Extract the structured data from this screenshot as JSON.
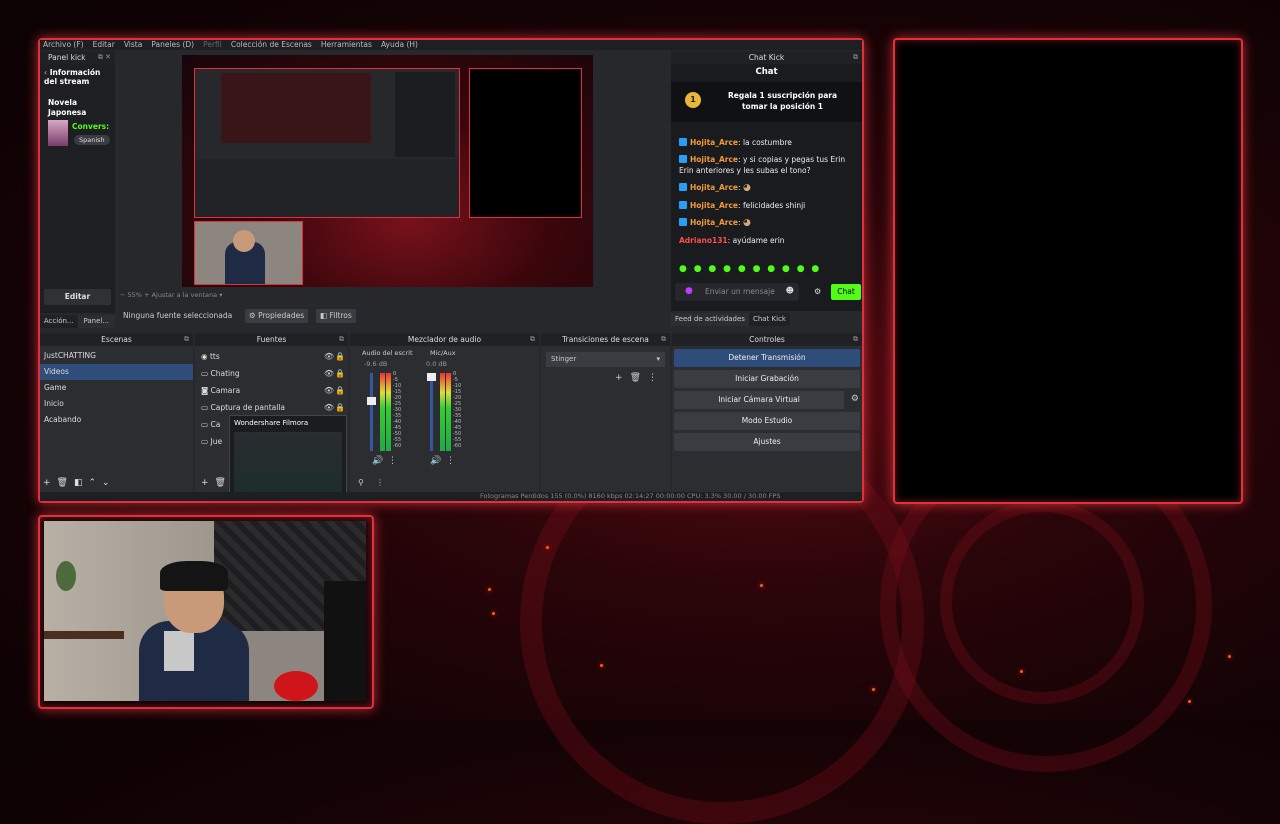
{
  "menu": {
    "items": [
      "Archivo (F)",
      "Editar",
      "Vista",
      "Paneles (D)",
      "Perfil",
      "Colección de Escenas",
      "Herramientas",
      "Ayuda (H)"
    ]
  },
  "panel_kick": {
    "title": "Panel kick",
    "stream_info_title": "Información del stream",
    "category": "Novela Japonesa",
    "conv": "Convers:",
    "language": "Spanish",
    "edit_button": "Editar"
  },
  "bottom_tabs": {
    "actions": "Acción...",
    "panel": "Panel..."
  },
  "preview_bar": {
    "zoom": "55%",
    "fit": "Ajustar a la ventana"
  },
  "source_bar": {
    "none": "Ninguna fuente seleccionada",
    "props": "Propiedades",
    "filters": "Filtros"
  },
  "chat": {
    "dock_title": "Chat Kick",
    "title": "Chat",
    "rank": "1",
    "promo": "Regala 1 suscripción para tomar la posición 1",
    "messages": [
      {
        "user": "Hojita_Arce",
        "text": "la costumbre"
      },
      {
        "user": "Hojita_Arce",
        "text": "y si copias y pegas tus Erin Erin anteriores y les subas el tono?"
      },
      {
        "user": "Hojita_Arce",
        "text": ""
      },
      {
        "user": "Hojita_Arce",
        "text": "felicidades shinji"
      },
      {
        "user": "Hojita_Arce",
        "text": ""
      },
      {
        "user": "Adriano131",
        "text": "ayúdame erin"
      }
    ],
    "placeholder": "Enviar un mensaje",
    "send": "Chat",
    "tab_feed": "Feed de actividades",
    "tab_chat": "Chat Kick"
  },
  "scenes": {
    "title": "Escenas",
    "items": [
      "JustCHATTING",
      "Videos",
      "Game",
      "Inicio",
      "Acabando"
    ],
    "selected": 1
  },
  "sources": {
    "title": "Fuentes",
    "items": [
      "tts",
      "Chating",
      "Camara",
      "Captura de pantalla",
      "Ca",
      "Jue"
    ]
  },
  "mixer": {
    "title": "Mezclador de audio",
    "ch1": "Audio del escrit",
    "ch1_db": "-9.6 dB",
    "ch2": "Mic/Aux",
    "ch2_db": "0.0 dB",
    "ticks": [
      "0",
      "-5",
      "-10",
      "-15",
      "-20",
      "-25",
      "-30",
      "-35",
      "-40",
      "-45",
      "-50",
      "-55",
      "-60"
    ]
  },
  "transitions": {
    "title": "Transiciones de escena",
    "selected": "Stinger"
  },
  "controls": {
    "title": "Controles",
    "items": [
      "Detener Transmisión",
      "Iniciar Grabación",
      "Iniciar Cámara Virtual",
      "Modo Estudio",
      "Ajustes"
    ]
  },
  "popup": {
    "title": "Wondershare Filmora"
  },
  "status": {
    "text": "Fotogramas Perdidos 155 (0.0%)    8160 kbps    02:14:27    00:00:00    CPU: 3.3%    30.00 / 30.00 FPS"
  },
  "colors": {
    "frame": "#e0303c",
    "accent_green": "#53fc18",
    "selection": "#2e4d7a"
  }
}
